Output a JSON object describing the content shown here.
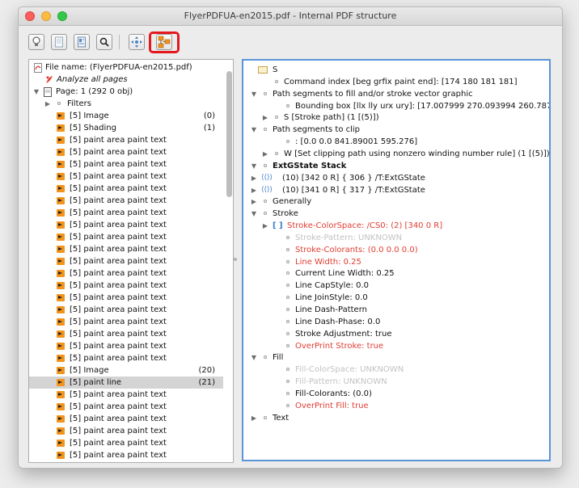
{
  "window": {
    "title": "FlyerPDFUA-en2015.pdf - Internal PDF structure"
  },
  "toolbar": {
    "buttons": [
      "bulb-icon",
      "page-icon",
      "page-structure-icon",
      "zoom-search-icon",
      "navigate-icon",
      "structure-tree-icon"
    ]
  },
  "left": {
    "file_label": "File name:  (FlyerPDFUA-en2015.pdf)",
    "analyze_label": "Analyze all pages",
    "page_label": "Page: 1   (292 0 obj)",
    "filters_label": "Filters",
    "items": [
      {
        "label": "[5] Image",
        "count": "(0)"
      },
      {
        "label": "[5] Shading",
        "count": "(1)"
      },
      {
        "label": "[5] paint area paint text",
        "count": ""
      },
      {
        "label": "[5] paint area paint text",
        "count": ""
      },
      {
        "label": "[5] paint area paint text",
        "count": ""
      },
      {
        "label": "[5] paint area paint text",
        "count": ""
      },
      {
        "label": "[5] paint area paint text",
        "count": ""
      },
      {
        "label": "[5] paint area paint text",
        "count": ""
      },
      {
        "label": "[5] paint area paint text",
        "count": ""
      },
      {
        "label": "[5] paint area paint text",
        "count": ""
      },
      {
        "label": "[5] paint area paint text",
        "count": ""
      },
      {
        "label": "[5] paint area paint text",
        "count": ""
      },
      {
        "label": "[5] paint area paint text",
        "count": ""
      },
      {
        "label": "[5] paint area paint text",
        "count": ""
      },
      {
        "label": "[5] paint area paint text",
        "count": ""
      },
      {
        "label": "[5] paint area paint text",
        "count": ""
      },
      {
        "label": "[5] paint area paint text",
        "count": ""
      },
      {
        "label": "[5] paint area paint text",
        "count": ""
      },
      {
        "label": "[5] paint area paint text",
        "count": ""
      },
      {
        "label": "[5] paint area paint text",
        "count": ""
      },
      {
        "label": "[5] paint area paint text",
        "count": ""
      },
      {
        "label": "[5] Image",
        "count": "(20)"
      },
      {
        "label": "[5] paint line",
        "count": "(21)",
        "selected": true
      },
      {
        "label": "[5] paint area paint text",
        "count": ""
      },
      {
        "label": "[5] paint area paint text",
        "count": ""
      },
      {
        "label": "[5] paint area paint text",
        "count": ""
      },
      {
        "label": "[5] paint area paint text",
        "count": ""
      },
      {
        "label": "[5] paint area paint text",
        "count": ""
      },
      {
        "label": "[5] paint area paint text",
        "count": ""
      },
      {
        "label": "[5] paint area paint text",
        "count": ""
      },
      {
        "label": "[5] paint area paint text",
        "count": ""
      }
    ]
  },
  "right": {
    "rows": [
      {
        "indent": 0,
        "tri": "",
        "icon": "folder",
        "text": "S",
        "style": ""
      },
      {
        "indent": 1,
        "tri": "",
        "icon": "dot",
        "text": "Command index [beg grfix paint end]:  [174 180 181 181]",
        "style": ""
      },
      {
        "indent": 0,
        "tri": "down",
        "icon": "dot",
        "text": "Path segments to fill and/or stroke vector graphic",
        "style": ""
      },
      {
        "indent": 2,
        "tri": "",
        "icon": "dot",
        "text": "Bounding box [llx lly urx ury]: [17.007999  270.093994  260.78799  4",
        "style": ""
      },
      {
        "indent": 1,
        "tri": "right",
        "icon": "dot",
        "text": "S  [Stroke path]  (1  [(5)])",
        "style": ""
      },
      {
        "indent": 0,
        "tri": "down",
        "icon": "dot",
        "text": "Path segments to clip",
        "style": ""
      },
      {
        "indent": 2,
        "tri": "",
        "icon": "dot",
        "text": ": [0.0  0.0  841.89001  595.276]",
        "style": ""
      },
      {
        "indent": 1,
        "tri": "right",
        "icon": "dot",
        "text": "W  [Set clipping path using nonzero winding number rule]  (1  [(5)])",
        "style": ""
      },
      {
        "indent": 0,
        "tri": "down",
        "icon": "dot",
        "text": "ExtGState Stack",
        "style": "bold"
      },
      {
        "indent": 0,
        "tri": "right",
        "icon": "dict",
        "text": "(10) [342 0 R]   { 306 }       /T:ExtGState",
        "style": ""
      },
      {
        "indent": 0,
        "tri": "right",
        "icon": "dict",
        "text": "(10) [341 0 R]   { 317 }       /T:ExtGState",
        "style": ""
      },
      {
        "indent": 0,
        "tri": "right",
        "icon": "dot",
        "text": "Generally",
        "style": ""
      },
      {
        "indent": 0,
        "tri": "down",
        "icon": "dot",
        "text": "Stroke",
        "style": ""
      },
      {
        "indent": 1,
        "tri": "right",
        "icon": "array",
        "text": "Stroke-ColorSpace:  /CS0:   (2)  [340 0 R]",
        "style": "red"
      },
      {
        "indent": 2,
        "tri": "",
        "icon": "dot",
        "text": "Stroke-Pattern: UNKNOWN",
        "style": "grey"
      },
      {
        "indent": 2,
        "tri": "",
        "icon": "dot",
        "text": "Stroke-Colorants: (0.0  0.0  0.0)",
        "style": "red"
      },
      {
        "indent": 2,
        "tri": "",
        "icon": "dot",
        "text": "Line Width: 0.25",
        "style": "red"
      },
      {
        "indent": 2,
        "tri": "",
        "icon": "dot",
        "text": "Current Line Width: 0.25",
        "style": ""
      },
      {
        "indent": 2,
        "tri": "",
        "icon": "dot",
        "text": "Line CapStyle: 0.0",
        "style": ""
      },
      {
        "indent": 2,
        "tri": "",
        "icon": "dot",
        "text": "Line JoinStyle: 0.0",
        "style": ""
      },
      {
        "indent": 2,
        "tri": "",
        "icon": "dot",
        "text": "Line Dash-Pattern",
        "style": ""
      },
      {
        "indent": 2,
        "tri": "",
        "icon": "dot",
        "text": "Line Dash-Phase: 0.0",
        "style": ""
      },
      {
        "indent": 2,
        "tri": "",
        "icon": "dot",
        "text": "Stroke Adjustment: true",
        "style": ""
      },
      {
        "indent": 2,
        "tri": "",
        "icon": "dot",
        "text": "OverPrint Stroke: true",
        "style": "red"
      },
      {
        "indent": 0,
        "tri": "down",
        "icon": "dot",
        "text": "Fill",
        "style": ""
      },
      {
        "indent": 2,
        "tri": "",
        "icon": "dot",
        "text": "Fill-ColorSpace: UNKNOWN",
        "style": "grey"
      },
      {
        "indent": 2,
        "tri": "",
        "icon": "dot",
        "text": "Fill-Pattern: UNKNOWN",
        "style": "grey"
      },
      {
        "indent": 2,
        "tri": "",
        "icon": "dot",
        "text": "Fill-Colorants: (0.0)",
        "style": ""
      },
      {
        "indent": 2,
        "tri": "",
        "icon": "dot",
        "text": "OverPrint Fill: true",
        "style": "red"
      },
      {
        "indent": 0,
        "tri": "right",
        "icon": "dot",
        "text": "Text",
        "style": ""
      }
    ]
  },
  "colors": {
    "accent": "#5a95d8",
    "highlight": "#e3191e",
    "warning_text": "#e03c31",
    "item_icon": "#f2941d"
  }
}
